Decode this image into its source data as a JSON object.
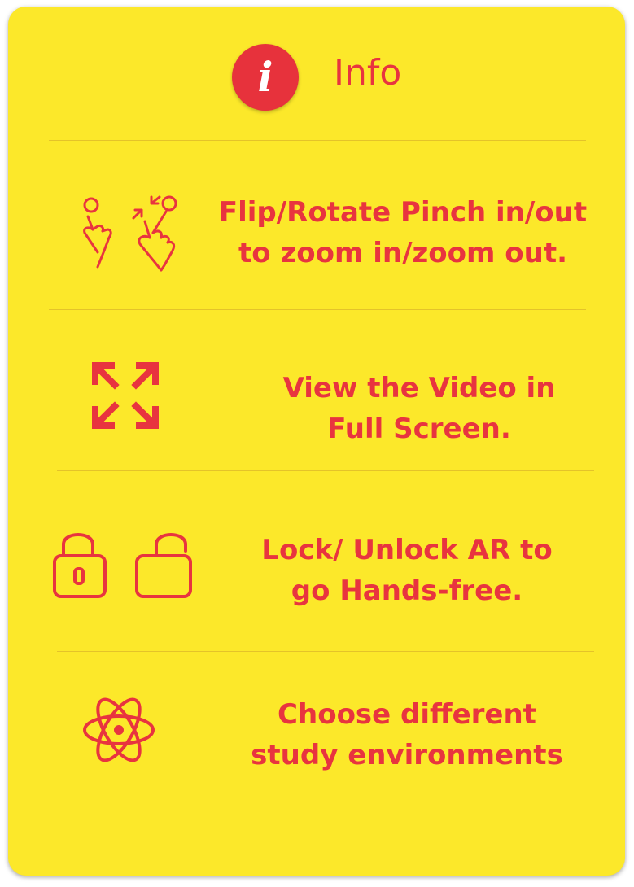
{
  "header": {
    "badge_glyph": "i",
    "title": "Info",
    "icon": "info-icon"
  },
  "items": [
    {
      "icon": "pinch-gesture-icon",
      "lines": [
        "Flip/Rotate Pinch in/out",
        "to zoom in/zoom out."
      ]
    },
    {
      "icon": "fullscreen-icon",
      "lines": [
        "View the Video in",
        "Full Screen."
      ]
    },
    {
      "icon": "lock-unlock-icon",
      "lines": [
        "Lock/ Unlock AR to",
        "go Hands-free."
      ]
    },
    {
      "icon": "atom-icon",
      "lines": [
        "Choose different",
        "study environments"
      ]
    }
  ],
  "colors": {
    "background": "#FCE82A",
    "accent": "#E8343F",
    "badge": "#E7323C"
  }
}
